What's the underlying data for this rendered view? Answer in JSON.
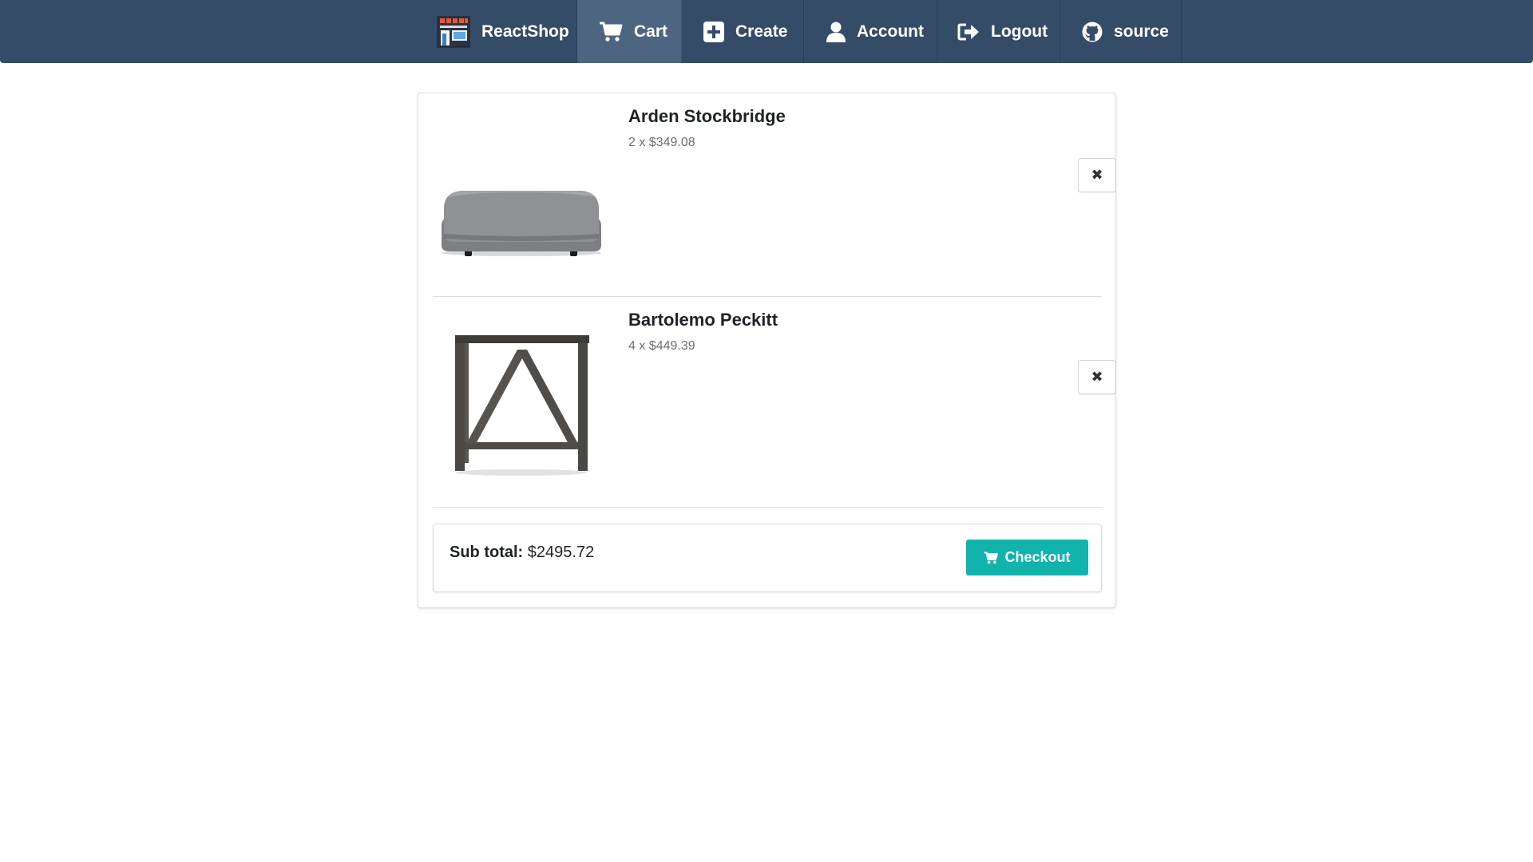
{
  "nav": {
    "brand_label": "ReactShop",
    "items": [
      {
        "label": "Cart",
        "icon": "cart-icon",
        "active": true
      },
      {
        "label": "Create",
        "icon": "plus-square-icon",
        "active": false
      },
      {
        "label": "Account",
        "icon": "user-icon",
        "active": false
      },
      {
        "label": "Logout",
        "icon": "sign-out-icon",
        "active": false
      },
      {
        "label": "source",
        "icon": "github-icon",
        "active": false
      }
    ]
  },
  "cart": {
    "items": [
      {
        "name": "Arden Stockbridge",
        "qty_price": "2 x $349.08",
        "image": "ottoman-image"
      },
      {
        "name": "Bartolemo Peckitt",
        "qty_price": "4 x $449.39",
        "image": "side-table-image"
      }
    ],
    "remove_symbol": "✖",
    "subtotal_label": "Sub total:",
    "subtotal_value": "$2495.72",
    "checkout_label": "Checkout"
  },
  "colors": {
    "navbar": "#354c68",
    "navbar_active": "#4d6580",
    "checkout": "#12b3ac"
  }
}
